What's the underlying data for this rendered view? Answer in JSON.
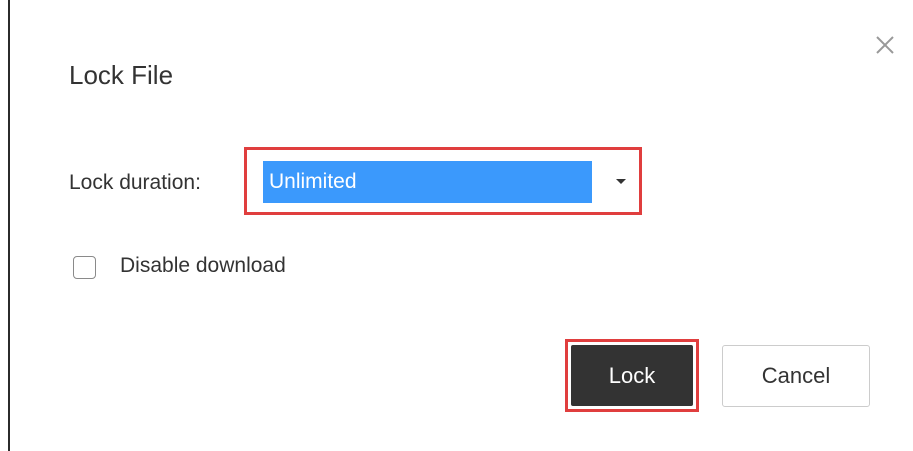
{
  "dialog": {
    "title": "Lock File",
    "close_icon": "close-icon"
  },
  "lock_duration": {
    "label": "Lock duration:",
    "selected_value": "Unlimited",
    "caret_icon": "chevron-down-icon"
  },
  "options": {
    "disable_download_label": "Disable download",
    "disable_download_checked": false
  },
  "actions": {
    "lock_label": "Lock",
    "cancel_label": "Cancel"
  },
  "colors": {
    "highlight": "#e03e3e",
    "selection": "#3b99fc",
    "primary_button": "#333333"
  }
}
